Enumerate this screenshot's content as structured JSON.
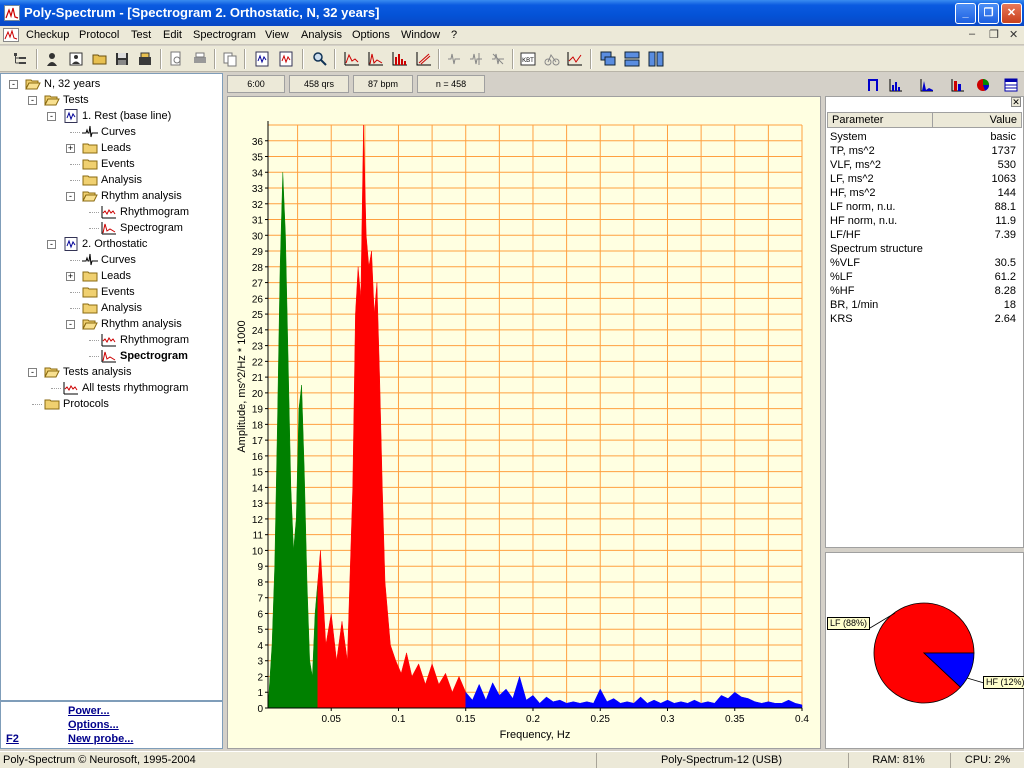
{
  "window": {
    "title": "Poly-Spectrum - [Spectrogram 2. Orthostatic, N, 32 years]"
  },
  "menu": {
    "items": [
      "Checkup",
      "Protocol",
      "Test",
      "Edit",
      "Spectrogram",
      "View",
      "Analysis",
      "Options",
      "Window",
      "?"
    ],
    "mdi_buttons": [
      "–",
      "❐",
      "✕"
    ]
  },
  "tree": [
    {
      "label": "N, 32 years",
      "icon": "open-folder-icon"
    },
    {
      "label": "Tests",
      "icon": "open-folder-icon"
    },
    {
      "label": "1. Rest (base line)",
      "icon": "test-icon"
    },
    {
      "label": "Curves",
      "icon": "ecg-curve-icon"
    },
    {
      "label": "Leads",
      "icon": "folder-icon"
    },
    {
      "label": "Events",
      "icon": "folder-icon"
    },
    {
      "label": "Analysis",
      "icon": "folder-icon"
    },
    {
      "label": "Rhythm analysis",
      "icon": "open-folder-icon"
    },
    {
      "label": "Rhythmogram",
      "icon": "rhythmogram-icon"
    },
    {
      "label": "Spectrogram",
      "icon": "spectrogram-icon"
    },
    {
      "label": "2. Orthostatic",
      "icon": "test-icon"
    },
    {
      "label": "Curves",
      "icon": "ecg-curve-icon"
    },
    {
      "label": "Leads",
      "icon": "folder-icon"
    },
    {
      "label": "Events",
      "icon": "folder-icon"
    },
    {
      "label": "Analysis",
      "icon": "folder-icon"
    },
    {
      "label": "Rhythm analysis",
      "icon": "open-folder-icon"
    },
    {
      "label": "Rhythmogram",
      "icon": "rhythmogram-icon"
    },
    {
      "label": "Spectrogram",
      "icon": "spectrogram-icon",
      "selected": true
    },
    {
      "label": "Tests analysis",
      "icon": "open-folder-icon"
    },
    {
      "label": "All tests rhythmogram",
      "icon": "rhythmogram-icon"
    },
    {
      "label": "Protocols",
      "icon": "folder-icon"
    }
  ],
  "links": {
    "power": "Power...",
    "options": "Options...",
    "new_probe": "New probe...",
    "hotkey": "F2"
  },
  "strip": {
    "time": "6:00",
    "qrs": "458 qrs",
    "bpm": "87 bpm",
    "n": "n = 458"
  },
  "params": {
    "header_param": "Parameter",
    "header_value": "Value",
    "rows": [
      {
        "name": "System",
        "value": "basic"
      },
      {
        "name": "TP, ms^2",
        "value": "1737"
      },
      {
        "name": "VLF, ms^2",
        "value": "530"
      },
      {
        "name": "LF, ms^2",
        "value": "1063"
      },
      {
        "name": "HF, ms^2",
        "value": "144"
      },
      {
        "name": "LF norm, n.u.",
        "value": "88.1"
      },
      {
        "name": "HF norm, n.u.",
        "value": "11.9"
      },
      {
        "name": "LF/HF",
        "value": "7.39"
      },
      {
        "name": "Spectrum structure",
        "value": ""
      },
      {
        "name": "%VLF",
        "value": "30.5"
      },
      {
        "name": "%LF",
        "value": "61.2"
      },
      {
        "name": "%HF",
        "value": "8.28"
      },
      {
        "name": "BR, 1/min",
        "value": "18"
      },
      {
        "name": "KRS",
        "value": "2.64"
      }
    ]
  },
  "pie": {
    "lf_label": "LF (88%)",
    "hf_label": "HF (12%)",
    "lf_percent": 88,
    "hf_percent": 12,
    "colors": {
      "lf": "#ff0000",
      "hf": "#0000ff"
    }
  },
  "statusbar": {
    "copyright": "Poly-Spectrum © Neurosoft, 1995-2004",
    "device": "Poly-Spectrum-12 (USB)",
    "ram": "RAM: 81%",
    "cpu": "CPU: 2%"
  },
  "chart_data": {
    "type": "area",
    "xlabel": "Frequency, Hz",
    "ylabel": "Amplitude, ms^2/Hz * 1000",
    "xlim": [
      0.003,
      0.4
    ],
    "ylim": [
      0,
      37
    ],
    "xticks": [
      0.05,
      0.1,
      0.15,
      0.2,
      0.25,
      0.3,
      0.35,
      0.4
    ],
    "xtick_labels": [
      "0.05",
      "0.1",
      "0.15",
      "0.2",
      "0.25",
      "0.3",
      "0.35",
      "0.4"
    ],
    "yticks": [
      0,
      1,
      2,
      3,
      4,
      5,
      6,
      7,
      8,
      9,
      10,
      11,
      12,
      13,
      14,
      15,
      16,
      17,
      18,
      19,
      20,
      21,
      22,
      23,
      24,
      25,
      26,
      27,
      28,
      29,
      30,
      31,
      32,
      33,
      34,
      35,
      36
    ],
    "grid": true,
    "colors": {
      "vlf": "#008000",
      "lf": "#ff0000",
      "hf": "#0000ff",
      "grid": "#ffa040",
      "background": "#ffffe1"
    },
    "series": [
      {
        "band": "VLF",
        "color": "#008000",
        "x": [
          0.003,
          0.006,
          0.008,
          0.01,
          0.012,
          0.014,
          0.016,
          0.018,
          0.02,
          0.022,
          0.024,
          0.026,
          0.028,
          0.03,
          0.032,
          0.034,
          0.036,
          0.038,
          0.04
        ],
        "y": [
          0,
          4,
          9,
          18,
          28,
          34,
          30,
          22,
          14,
          10,
          12,
          19,
          20.5,
          15,
          8,
          3,
          2,
          6,
          8
        ]
      },
      {
        "band": "LF",
        "color": "#ff0000",
        "x": [
          0.04,
          0.042,
          0.044,
          0.046,
          0.05,
          0.054,
          0.058,
          0.062,
          0.066,
          0.068,
          0.07,
          0.072,
          0.074,
          0.076,
          0.078,
          0.08,
          0.082,
          0.084,
          0.086,
          0.088,
          0.09,
          0.094,
          0.098,
          0.102,
          0.106,
          0.11,
          0.115,
          0.12,
          0.125,
          0.13,
          0.135,
          0.14,
          0.145,
          0.15
        ],
        "y": [
          8,
          10,
          7,
          4,
          6,
          3,
          5.5,
          3,
          14,
          25,
          28,
          26,
          37,
          30,
          28,
          29,
          25,
          27,
          21,
          14,
          8,
          4,
          3,
          2.2,
          3.5,
          2,
          2.8,
          1.5,
          2.8,
          1.5,
          2.2,
          1,
          2,
          1
        ]
      },
      {
        "band": "HF",
        "color": "#0000ff",
        "x": [
          0.15,
          0.155,
          0.16,
          0.165,
          0.17,
          0.175,
          0.18,
          0.185,
          0.19,
          0.195,
          0.2,
          0.205,
          0.21,
          0.215,
          0.22,
          0.225,
          0.23,
          0.235,
          0.24,
          0.245,
          0.25,
          0.255,
          0.26,
          0.265,
          0.27,
          0.275,
          0.28,
          0.285,
          0.29,
          0.295,
          0.3,
          0.305,
          0.31,
          0.315,
          0.32,
          0.325,
          0.33,
          0.335,
          0.34,
          0.345,
          0.35,
          0.355,
          0.36,
          0.365,
          0.37,
          0.375,
          0.38,
          0.385,
          0.39,
          0.395,
          0.4
        ],
        "y": [
          1,
          0.5,
          1.5,
          0.5,
          1.6,
          0.8,
          1.2,
          0.6,
          2,
          0.5,
          0.8,
          0.3,
          0.7,
          0.4,
          0.5,
          0.3,
          0.4,
          0.3,
          0.4,
          0.3,
          1.2,
          0.4,
          0.6,
          0.3,
          0.4,
          0.3,
          0.7,
          0.3,
          0.5,
          0.3,
          0.5,
          0.3,
          0.4,
          0.3,
          0.5,
          0.3,
          0.4,
          0.3,
          0.8,
          0.6,
          1,
          0.7,
          0.6,
          0.4,
          0.3,
          0.4,
          0.3,
          0.3,
          0.5,
          0.3,
          0.2
        ]
      }
    ]
  }
}
